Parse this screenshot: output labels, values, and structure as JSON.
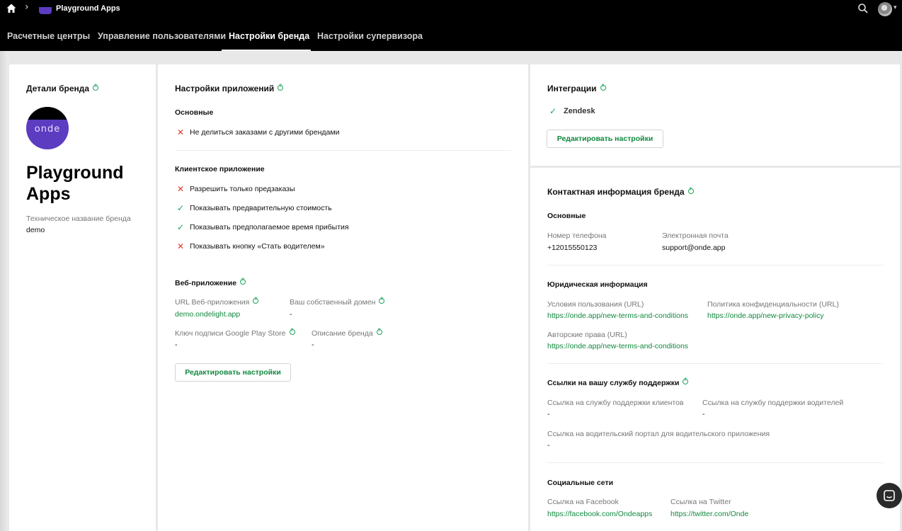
{
  "header": {
    "app_name": "Playground Apps",
    "tabs": [
      {
        "label": "Расчетные центры"
      },
      {
        "label": "Управление пользователями"
      },
      {
        "label": "Настройки бренда"
      },
      {
        "label": "Настройки супервизора"
      }
    ],
    "active_tab": "Настройки бренда"
  },
  "brand": {
    "title": "Детали бренда",
    "logo_text": "onde",
    "name": "Playground Apps",
    "tech_name_label": "Техническое название бренда",
    "tech_name_value": "demo"
  },
  "app_settings": {
    "title": "Настройки приложений",
    "basic_title": "Основные",
    "basic_options": [
      {
        "label": "Не делиться заказами с другими брендами",
        "enabled": false
      }
    ],
    "client_title": "Клиентское приложение",
    "client_options": [
      {
        "label": "Разрешить только предзаказы",
        "enabled": false
      },
      {
        "label": "Показывать предварительную стоимость",
        "enabled": true
      },
      {
        "label": "Показывать предполагаемое время прибытия",
        "enabled": true
      },
      {
        "label": "Показывать кнопку «Стать водителем»",
        "enabled": false
      }
    ],
    "web_title": "Веб-приложение",
    "web_url_label": "URL Веб-приложения",
    "web_url_value": "demo.ondelight.app",
    "own_domain_label": "Ваш собственный домен",
    "own_domain_value": "-",
    "play_key_label": "Ключ подписи Google Play Store",
    "play_key_value": "-",
    "brand_desc_label": "Описание бренда",
    "brand_desc_value": "-",
    "edit_button": "Редактировать настройки"
  },
  "integrations": {
    "title": "Интеграции",
    "items": [
      {
        "label": "Zendesk",
        "enabled": true
      }
    ],
    "edit_button": "Редактировать настройки"
  },
  "contacts": {
    "title": "Контактная информация бренда",
    "basic_title": "Основные",
    "phone_label": "Номер телефона",
    "phone_value": "+12015550123",
    "email_label": "Электронная почта",
    "email_value": "support@onde.app",
    "legal_title": "Юридическая информация",
    "terms_label": "Условия пользования (URL)",
    "terms_value": "https://onde.app/new-terms-and-conditions",
    "privacy_label": "Политика конфиденциальности (URL)",
    "privacy_value": "https://onde.app/new-privacy-policy",
    "copyright_label": "Авторские права (URL)",
    "copyright_value": "https://onde.app/new-terms-and-conditions",
    "support_title": "Ссылки на вашу службу поддержки",
    "client_support_label": "Ссылка на службу поддержки клиентов",
    "client_support_value": "-",
    "driver_support_label": "Ссылка на службу поддержки водителей",
    "driver_support_value": "-",
    "driver_portal_label": "Ссылка на водительский портал для водительского приложения",
    "driver_portal_value": "-",
    "social_title": "Социальные сети",
    "facebook_label": "Ссылка на Facebook",
    "facebook_value": "https://facebook.com/Ondeapps",
    "twitter_label": "Ссылка на Twitter",
    "twitter_value": "https://twitter.com/Onde"
  },
  "colors": {
    "accent_green": "#11893f",
    "error_red": "#e0342a",
    "brand_purple": "#5c3cc0",
    "topbar": "#000000"
  },
  "icons": [
    "home-icon",
    "chevron-right-icon",
    "search-icon",
    "avatar",
    "help-icon",
    "check-icon",
    "cross-icon",
    "chat-icon"
  ]
}
